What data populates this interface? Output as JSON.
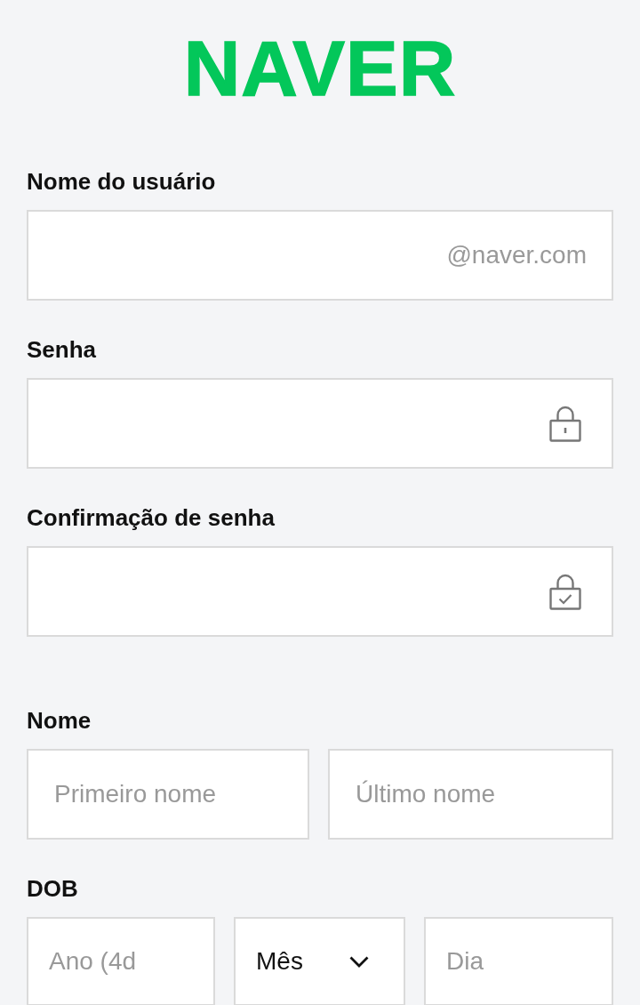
{
  "logo": {
    "text": "NAVER"
  },
  "account_fields": [
    {
      "label": "Nome do usuário",
      "kind": "suffix",
      "suffix": "@naver.com"
    },
    {
      "label": "Senha",
      "kind": "password"
    },
    {
      "label": "Confirmação de senha",
      "kind": "password_confirm"
    }
  ],
  "name": {
    "label": "Nome",
    "fields": [
      {
        "placeholder": "Primeiro nome"
      },
      {
        "placeholder": "Último nome"
      }
    ]
  },
  "dob": {
    "label": "DOB",
    "fields": [
      {
        "kind": "input",
        "placeholder": "Ano (4d"
      },
      {
        "kind": "select",
        "value": "Mês"
      },
      {
        "kind": "input",
        "placeholder": "Dia"
      }
    ]
  }
}
